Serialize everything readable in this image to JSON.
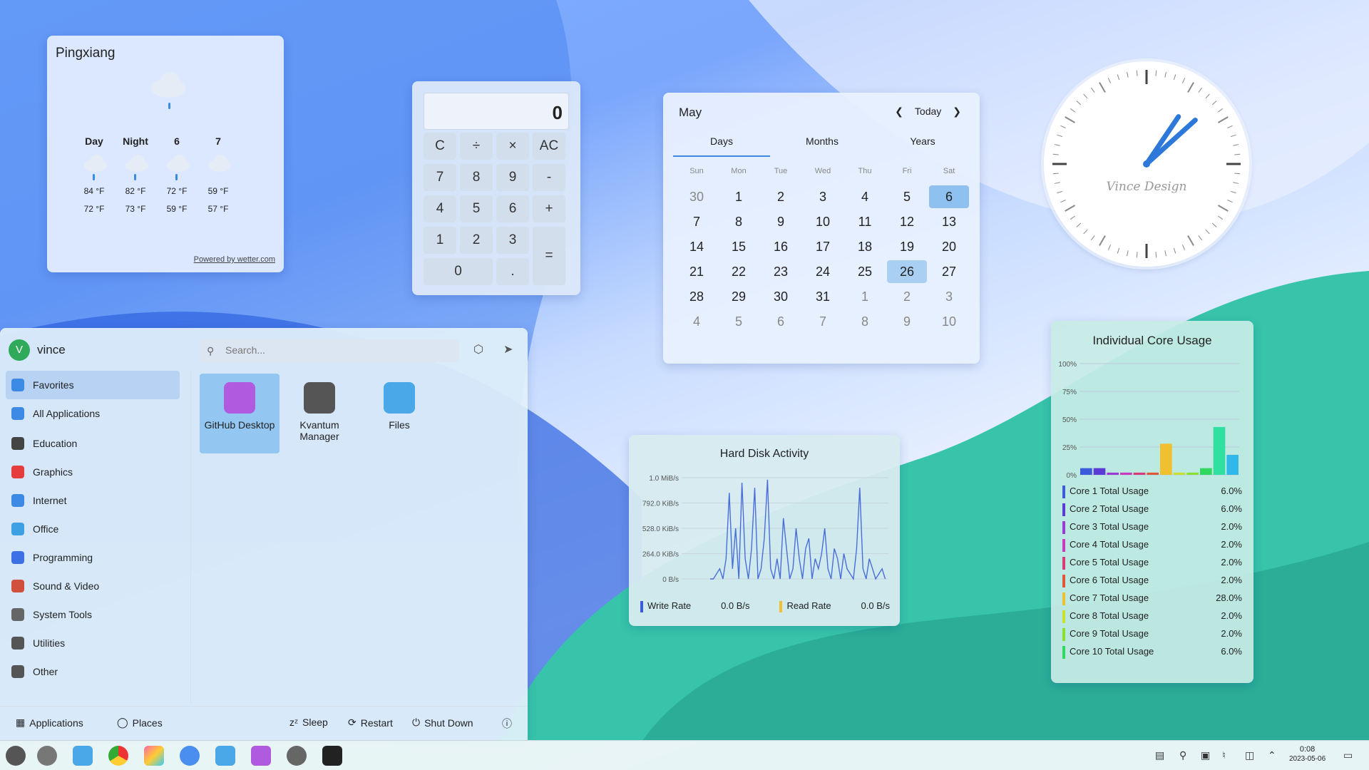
{
  "weather": {
    "city": "Pingxiang",
    "columns": [
      {
        "label": "Day",
        "high": "84 °F",
        "low": "72 °F",
        "icon": "rain-cloud-icon"
      },
      {
        "label": "Night",
        "high": "82 °F",
        "low": "73 °F",
        "icon": "rain-cloud-icon"
      },
      {
        "label": "6",
        "high": "72 °F",
        "low": "59 °F",
        "icon": "rain-cloud-icon"
      },
      {
        "label": "7",
        "high": "59 °F",
        "low": "57 °F",
        "icon": "cloud-icon"
      }
    ],
    "powered_by": "Powered by wetter.com"
  },
  "calculator": {
    "display": "0",
    "buttons": [
      "C",
      "÷",
      "×",
      "AC",
      "7",
      "8",
      "9",
      "-",
      "4",
      "5",
      "6",
      "+",
      "1",
      "2",
      "3",
      "=",
      "0",
      "."
    ]
  },
  "calendar": {
    "month": "May",
    "today_label": "Today",
    "tabs": [
      "Days",
      "Months",
      "Years"
    ],
    "active_tab": "Days",
    "weekdays": [
      "Sun",
      "Mon",
      "Tue",
      "Wed",
      "Thu",
      "Fri",
      "Sat"
    ],
    "days": [
      "30",
      "1",
      "2",
      "3",
      "4",
      "5",
      "6",
      "7",
      "8",
      "9",
      "10",
      "11",
      "12",
      "13",
      "14",
      "15",
      "16",
      "17",
      "18",
      "19",
      "20",
      "21",
      "22",
      "23",
      "24",
      "25",
      "26",
      "27",
      "28",
      "29",
      "30",
      "31",
      "1",
      "2",
      "3",
      "4",
      "5",
      "6",
      "7",
      "8",
      "9",
      "10"
    ],
    "selected_day": "6",
    "highlighted_day": "26"
  },
  "clock": {
    "brand": "Vince Design",
    "hour": 1,
    "minute": 8
  },
  "core_usage": {
    "title": "Individual Core Usage",
    "y_ticks": [
      "100%",
      "75%",
      "50%",
      "25%",
      "0%"
    ],
    "cores": [
      {
        "label": "Core 1 Total Usage",
        "value": "6.0%",
        "v": 6.0,
        "color": "#3b5bdb"
      },
      {
        "label": "Core 2 Total Usage",
        "value": "6.0%",
        "v": 6.0,
        "color": "#5b3bd6"
      },
      {
        "label": "Core 3 Total Usage",
        "value": "2.0%",
        "v": 2.0,
        "color": "#9b3bd6"
      },
      {
        "label": "Core 4 Total Usage",
        "value": "2.0%",
        "v": 2.0,
        "color": "#c83bbf"
      },
      {
        "label": "Core 5 Total Usage",
        "value": "2.0%",
        "v": 2.0,
        "color": "#d63b7a"
      },
      {
        "label": "Core 6 Total Usage",
        "value": "2.0%",
        "v": 2.0,
        "color": "#e0583b"
      },
      {
        "label": "Core 7 Total Usage",
        "value": "28.0%",
        "v": 28.0,
        "color": "#f0c030"
      },
      {
        "label": "Core 8 Total Usage",
        "value": "2.0%",
        "v": 2.0,
        "color": "#c8e030"
      },
      {
        "label": "Core 9 Total Usage",
        "value": "2.0%",
        "v": 2.0,
        "color": "#88e030"
      },
      {
        "label": "Core 10 Total Usage",
        "value": "6.0%",
        "v": 6.0,
        "color": "#30d860"
      }
    ],
    "extra_bars": [
      {
        "v": 43,
        "color": "#30e0a0"
      },
      {
        "v": 18,
        "color": "#30b8e8"
      }
    ]
  },
  "disk": {
    "title": "Hard Disk Activity",
    "y_ticks": [
      "1.0 MiB/s",
      "792.0 KiB/s",
      "528.0 KiB/s",
      "264.0 KiB/s",
      "0 B/s"
    ],
    "write_label": "Write Rate",
    "write_value": "0.0 B/s",
    "write_color": "#3b5bdb",
    "read_label": "Read Rate",
    "read_value": "0.0 B/s",
    "read_color": "#f0c030"
  },
  "launcher": {
    "username": "vince",
    "avatar_letter": "V",
    "search_placeholder": "Search...",
    "categories": [
      {
        "label": "Favorites",
        "icon": "bookmark-icon",
        "color": "#3d8ae5"
      },
      {
        "label": "All Applications",
        "icon": "grid-icon",
        "color": "#3d8ae5"
      },
      {
        "label": "Education",
        "icon": "education-icon",
        "color": "#444"
      },
      {
        "label": "Graphics",
        "icon": "graphics-icon",
        "color": "#e53d3d"
      },
      {
        "label": "Internet",
        "icon": "internet-icon",
        "color": "#3d8ae5"
      },
      {
        "label": "Office",
        "icon": "office-icon",
        "color": "#3da0e5"
      },
      {
        "label": "Programming",
        "icon": "programming-icon",
        "color": "#3d70e5"
      },
      {
        "label": "Sound & Video",
        "icon": "sound-video-icon",
        "color": "#d0503d"
      },
      {
        "label": "System Tools",
        "icon": "system-tools-icon",
        "color": "#666"
      },
      {
        "label": "Utilities",
        "icon": "utilities-icon",
        "color": "#555"
      },
      {
        "label": "Other",
        "icon": "other-icon",
        "color": "#555"
      }
    ],
    "apps": [
      {
        "label": "GitHub Desktop",
        "icon": "github-desktop-icon",
        "color": "#b05ae0"
      },
      {
        "label": "Kvantum Manager",
        "icon": "kvantum-icon",
        "color": "#555"
      },
      {
        "label": "Files",
        "icon": "folder-icon",
        "color": "#4aa8e8"
      }
    ],
    "footer": {
      "applications": "Applications",
      "places": "Places",
      "sleep": "Sleep",
      "restart": "Restart",
      "shutdown": "Shut Down"
    }
  },
  "taskbar": {
    "time": "0:08",
    "date": "2023-05-06"
  }
}
